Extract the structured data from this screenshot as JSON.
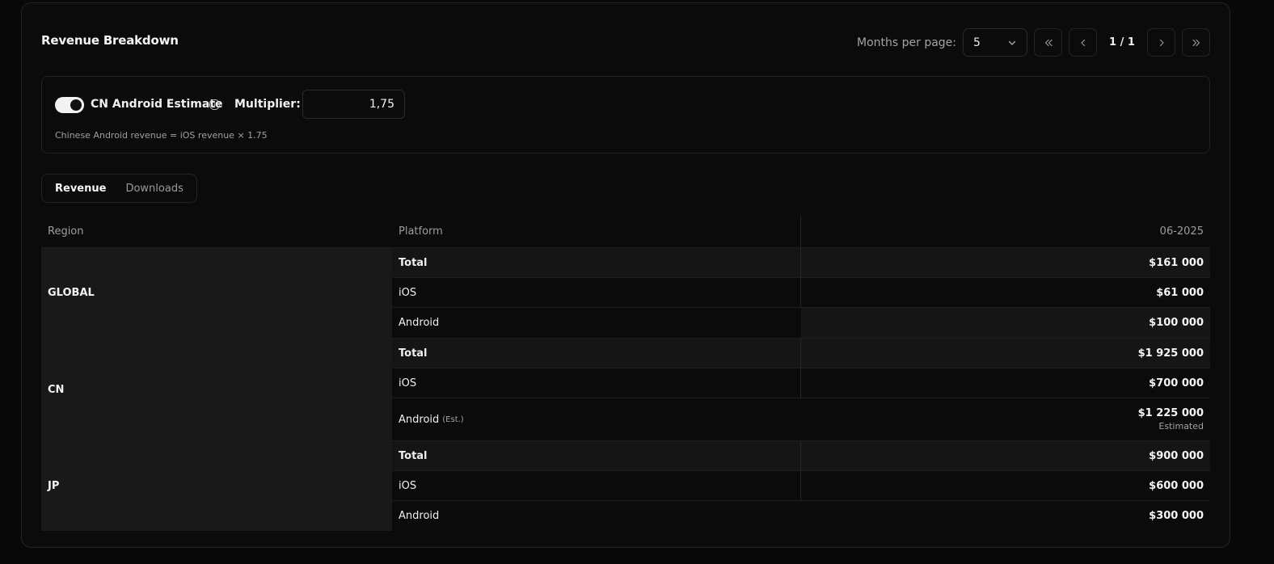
{
  "header": {
    "title": "Revenue Breakdown",
    "months_per_page_label": "Months per page:",
    "months_per_page_value": "5",
    "page_indicator": "1 / 1"
  },
  "estimate": {
    "toggle_on": true,
    "label": "CN Android Estimate",
    "multiplier_label": "Multiplier:",
    "multiplier_value": "1,75",
    "note": "Chinese Android revenue = iOS revenue × 1.75"
  },
  "tabs": [
    {
      "label": "Revenue",
      "active": true
    },
    {
      "label": "Downloads",
      "active": false
    }
  ],
  "table": {
    "headers": {
      "region": "Region",
      "platform": "Platform",
      "month": "06-2025"
    },
    "groups": [
      {
        "region": "GLOBAL",
        "rows": [
          {
            "platform": "Total",
            "value": "$161 000"
          },
          {
            "platform": "iOS",
            "value": "$61 000"
          },
          {
            "platform": "Android",
            "value": "$100 000"
          }
        ]
      },
      {
        "region": "CN",
        "rows": [
          {
            "platform": "Total",
            "value": "$1 925 000"
          },
          {
            "platform": "iOS",
            "value": "$700 000"
          },
          {
            "platform": "Android",
            "tag": "(Est.)",
            "value": "$1 225 000",
            "sub": "Estimated"
          }
        ]
      },
      {
        "region": "JP",
        "rows": [
          {
            "platform": "Total",
            "value": "$900 000"
          },
          {
            "platform": "iOS",
            "value": "$600 000"
          },
          {
            "platform": "Android",
            "value": "$300 000"
          }
        ]
      }
    ]
  }
}
